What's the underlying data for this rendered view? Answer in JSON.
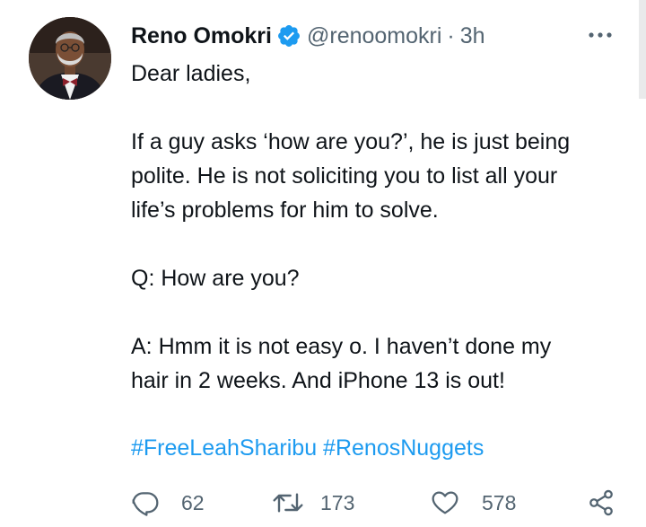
{
  "author": {
    "name": "Reno Omokri",
    "handle": "@renoomokri",
    "separator": "·",
    "time": "3h"
  },
  "tweet": {
    "lines": [
      "Dear ladies,",
      "",
      "If a guy asks ‘how are you?’, he is just being",
      "polite. He is not soliciting you to list all your",
      "life’s problems for him to solve.",
      "",
      "Q: How are you?",
      "",
      "A: Hmm it is not easy o. I haven’t done my",
      "hair in 2 weeks. And iPhone 13 is out!"
    ],
    "hashtags": [
      "#FreeLeahSharibu",
      "#RenosNuggets"
    ]
  },
  "actions": {
    "replies": "62",
    "retweets": "173",
    "likes": "578"
  },
  "colors": {
    "text": "#0f1419",
    "secondary": "#536471",
    "link": "#1d9bf0",
    "verified": "#1d9bf0"
  },
  "icons": {
    "verified": "verified-badge-icon",
    "more": "more-horizontal-icon",
    "reply": "reply-icon",
    "retweet": "retweet-icon",
    "like": "heart-icon",
    "share": "share-icon"
  }
}
